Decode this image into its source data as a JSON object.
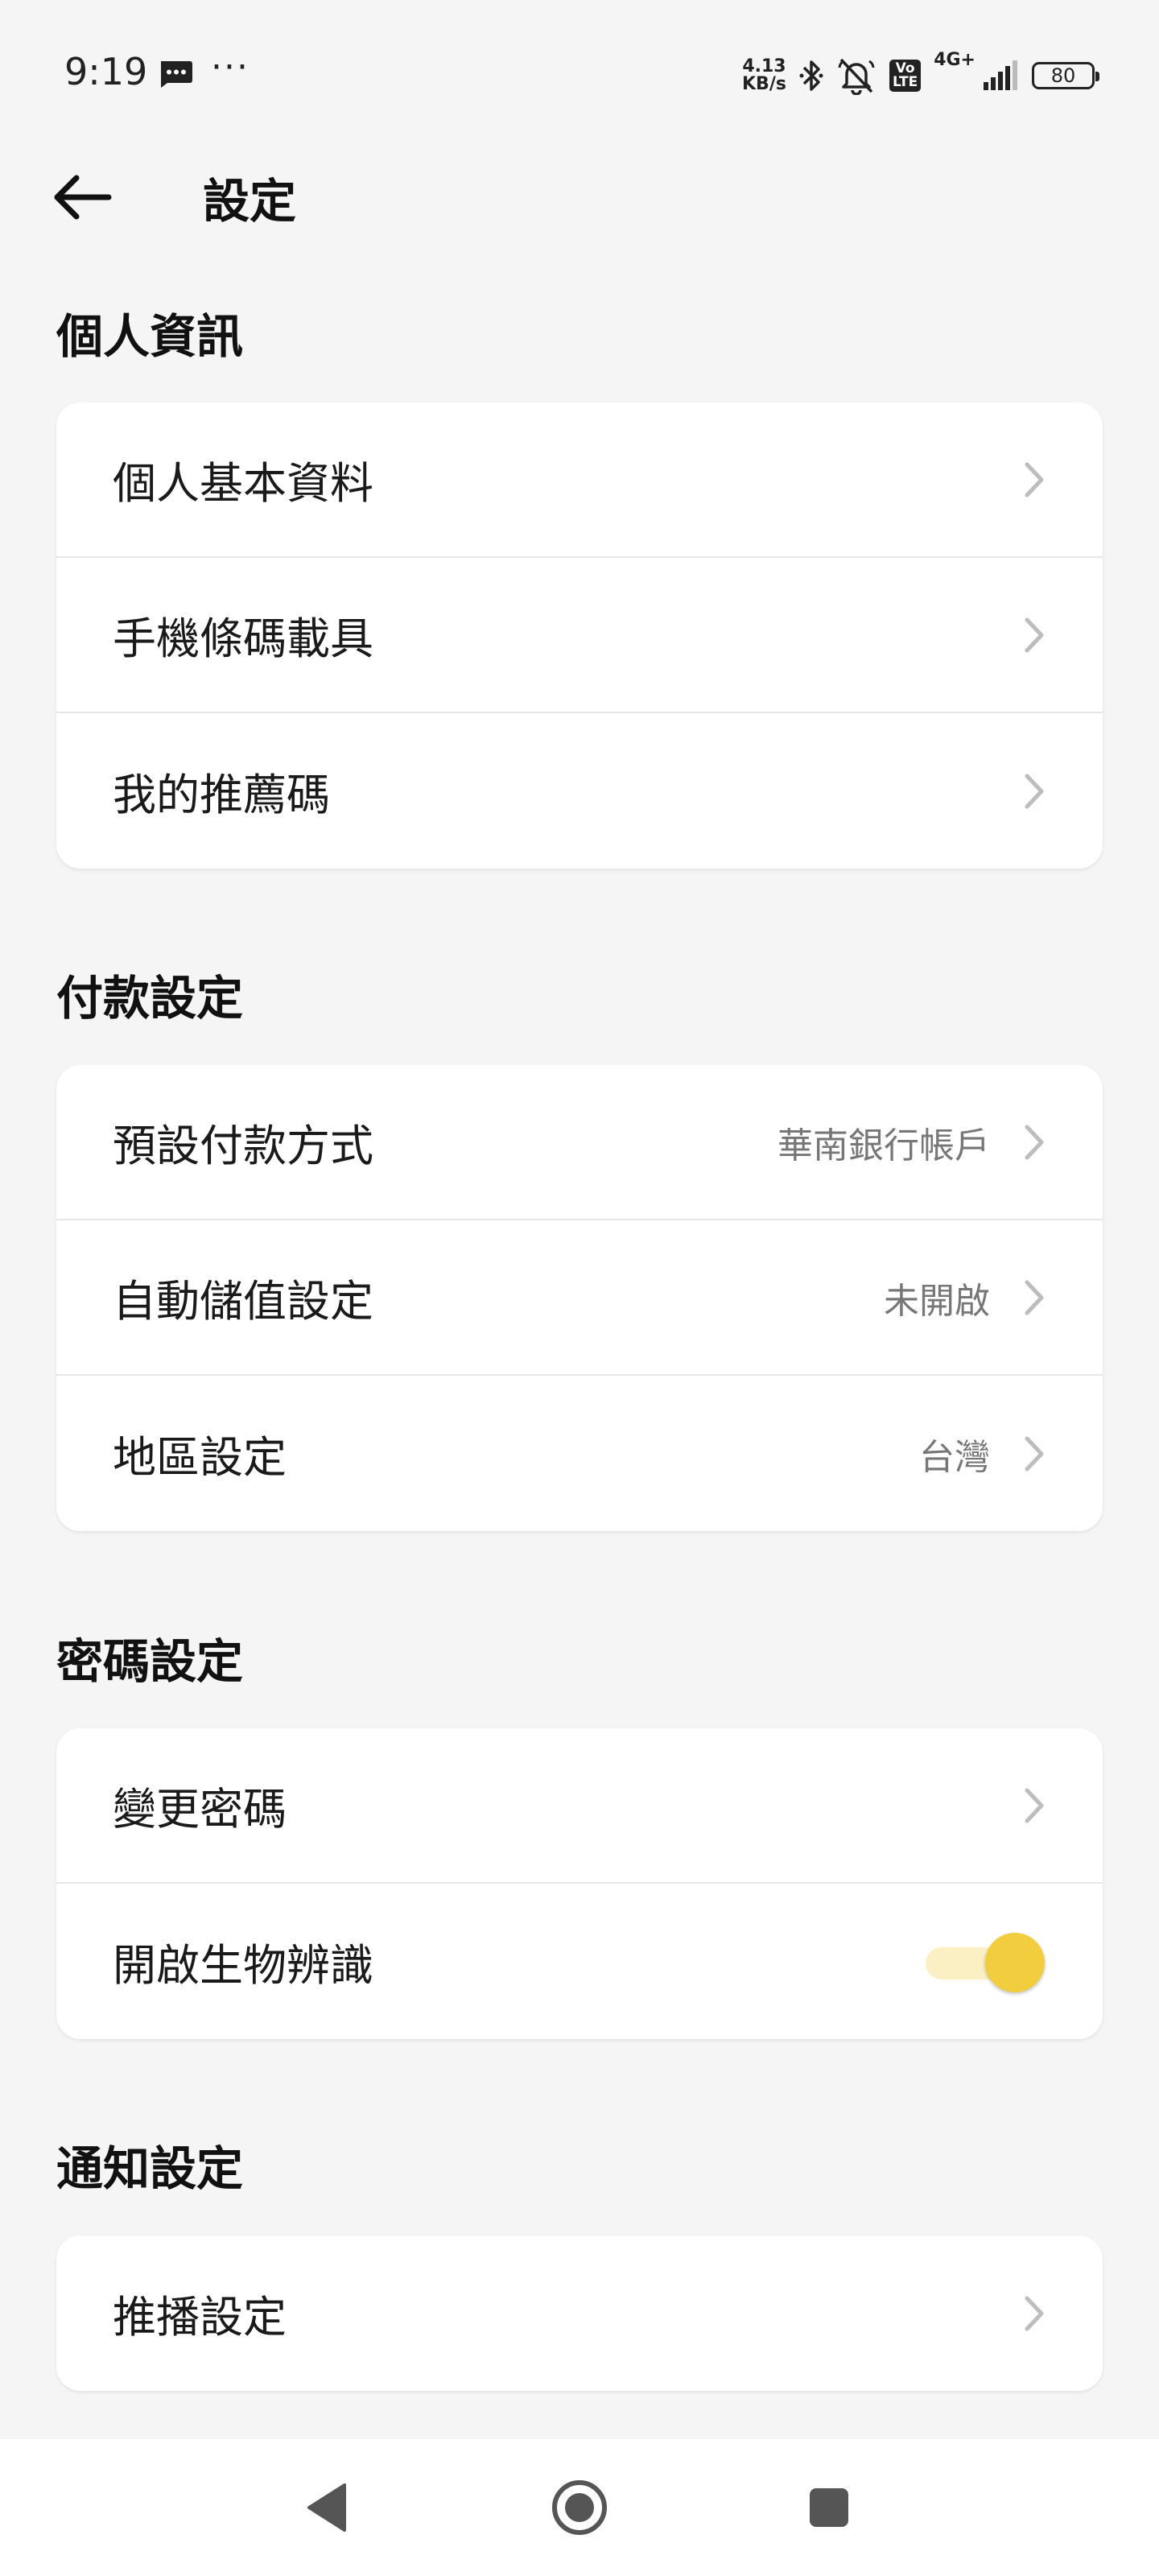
{
  "status_bar": {
    "time": "9:19",
    "more": "···",
    "speed_value": "4.13",
    "speed_unit": "KB/s",
    "volte_top": "Vo",
    "volte_bottom": "LTE",
    "network": "4G+",
    "battery": "80",
    "icons": [
      "message-icon",
      "bluetooth-icon",
      "mute-icon",
      "signal-icon",
      "battery-icon"
    ]
  },
  "header": {
    "title": "設定",
    "back_icon": "arrow-left-icon"
  },
  "sections": {
    "personal": {
      "title": "個人資訊",
      "items": [
        {
          "label": "個人基本資料"
        },
        {
          "label": "手機條碼載具"
        },
        {
          "label": "我的推薦碼"
        }
      ]
    },
    "payment": {
      "title": "付款設定",
      "items": [
        {
          "label": "預設付款方式",
          "value": "華南銀行帳戶"
        },
        {
          "label": "自動儲值設定",
          "value": "未開啟"
        },
        {
          "label": "地區設定",
          "value": "台灣"
        }
      ]
    },
    "password": {
      "title": "密碼設定",
      "items": [
        {
          "label": "變更密碼"
        },
        {
          "label": "開啟生物辨識",
          "toggle_on": true
        }
      ]
    },
    "notification": {
      "title": "通知設定",
      "items": [
        {
          "label": "推播設定"
        }
      ]
    }
  },
  "colors": {
    "background": "#f5f5f5",
    "card": "#ffffff",
    "accent": "#f2cd3d",
    "accent_light": "#fbf0c4",
    "secondary_text": "#777777"
  },
  "nav_bar": {
    "icons": [
      "nav-back-icon",
      "nav-home-icon",
      "nav-recents-icon"
    ]
  }
}
